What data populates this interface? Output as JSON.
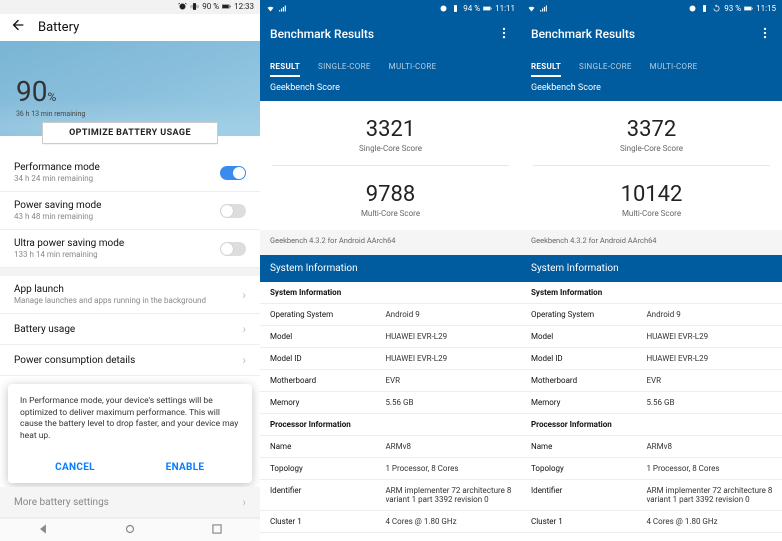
{
  "screen1": {
    "status": {
      "battery_pct": "90 %",
      "time": "12:33"
    },
    "title": "Battery",
    "big_pct": "90",
    "pct_sym": "%",
    "remaining": "36 h 13 min remaining",
    "optimize": "OPTIMIZE BATTERY USAGE",
    "rows": {
      "perf": {
        "label": "Performance mode",
        "sub": "34 h 24 min remaining"
      },
      "psave": {
        "label": "Power saving mode",
        "sub": "43 h 48 min remaining"
      },
      "ultra": {
        "label": "Ultra power saving mode",
        "sub": "133 h 14 min remaining"
      },
      "launch": {
        "label": "App launch",
        "sub": "Manage launches and apps running in the background"
      },
      "usage": {
        "label": "Battery usage"
      },
      "consump": {
        "label": "Power consumption details"
      },
      "more": {
        "label": "More battery settings"
      }
    },
    "dialog": {
      "msg": "In Performance mode, your device's settings will be optimized to deliver maximum performance. This will cause the battery level to drop faster, and your device may heat up.",
      "cancel": "CANCEL",
      "enable": "ENABLE"
    }
  },
  "screen2": {
    "status": {
      "battery_pct": "94 %",
      "time": "11:11"
    },
    "title": "Benchmark Results",
    "tabs": {
      "result": "RESULT",
      "single": "SINGLE-CORE",
      "multi": "MULTI-CORE"
    },
    "subhd": "Geekbench Score",
    "single_val": "3321",
    "single_lbl": "Single-Core Score",
    "multi_val": "9788",
    "multi_lbl": "Multi-Core Score",
    "version": "Geekbench 4.3.2 for Android AArch64",
    "sys_hd": "System Information",
    "sys_section": "System Information",
    "sys": {
      "os_k": "Operating System",
      "os_v": "Android 9",
      "model_k": "Model",
      "model_v": "HUAWEI EVR-L29",
      "mid_k": "Model ID",
      "mid_v": "HUAWEI EVR-L29",
      "mb_k": "Motherboard",
      "mb_v": "EVR",
      "mem_k": "Memory",
      "mem_v": "5.56 GB"
    },
    "proc_section": "Processor Information",
    "proc": {
      "name_k": "Name",
      "name_v": "ARMv8",
      "topo_k": "Topology",
      "topo_v": "1 Processor, 8 Cores",
      "id_k": "Identifier",
      "id_v": "ARM implementer 72 architecture 8 variant 1 part 3392 revision 0",
      "c1_k": "Cluster 1",
      "c1_v": "4 Cores @ 1.80 GHz"
    }
  },
  "screen3": {
    "status": {
      "battery_pct": "93 %",
      "time": "11:15"
    },
    "title": "Benchmark Results",
    "tabs": {
      "result": "RESULT",
      "single": "SINGLE-CORE",
      "multi": "MULTI-CORE"
    },
    "subhd": "Geekbench Score",
    "single_val": "3372",
    "single_lbl": "Single-Core Score",
    "multi_val": "10142",
    "multi_lbl": "Multi-Core Score",
    "version": "Geekbench 4.3.2 for Android AArch64",
    "sys_hd": "System Information",
    "sys_section": "System Information",
    "sys": {
      "os_k": "Operating System",
      "os_v": "Android 9",
      "model_k": "Model",
      "model_v": "HUAWEI EVR-L29",
      "mid_k": "Model ID",
      "mid_v": "HUAWEI EVR-L29",
      "mb_k": "Motherboard",
      "mb_v": "EVR",
      "mem_k": "Memory",
      "mem_v": "5.56 GB"
    },
    "proc_section": "Processor Information",
    "proc": {
      "name_k": "Name",
      "name_v": "ARMv8",
      "topo_k": "Topology",
      "topo_v": "1 Processor, 8 Cores",
      "id_k": "Identifier",
      "id_v": "ARM implementer 72 architecture 8 variant 1 part 3392 revision 0",
      "c1_k": "Cluster 1",
      "c1_v": "4 Cores @ 1.80 GHz"
    }
  }
}
